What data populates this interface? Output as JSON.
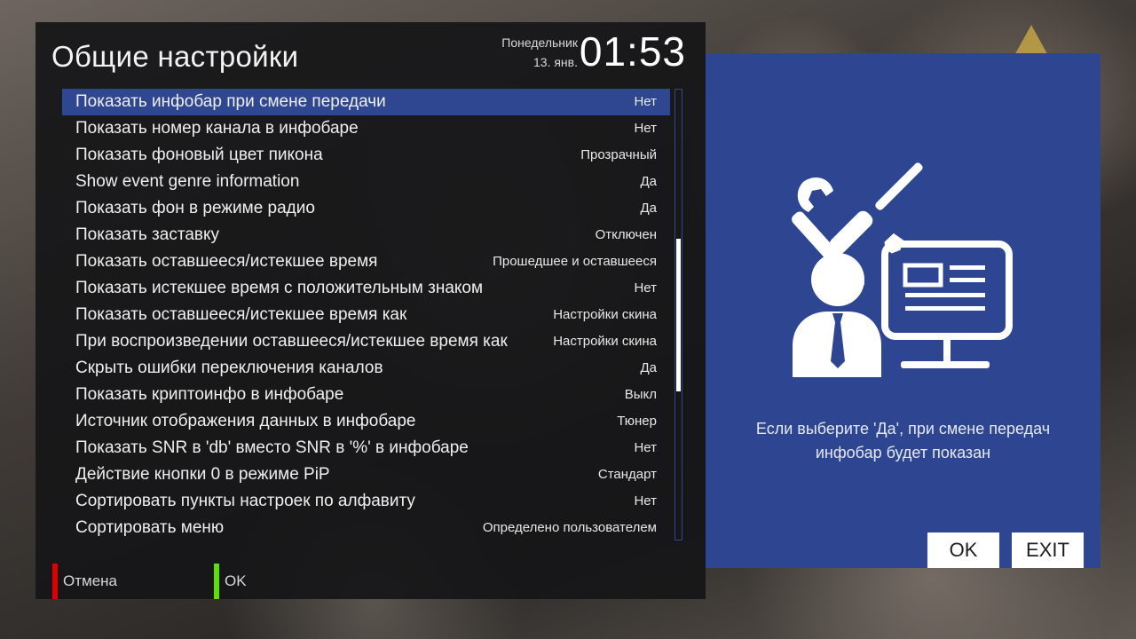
{
  "header": {
    "title": "Общие настройки",
    "weekday": "Понедельник",
    "date": "13. янв.",
    "time": "01:53"
  },
  "settings": [
    {
      "label": "Показать инфобар при смене передачи",
      "value": "Нет",
      "selected": true
    },
    {
      "label": "Показать номер канала в инфобаре",
      "value": "Нет"
    },
    {
      "label": "Показать фоновый цвет пикона",
      "value": "Прозрачный"
    },
    {
      "label": "Show event genre information",
      "value": "Да"
    },
    {
      "label": "Показать фон в режиме радио",
      "value": "Да"
    },
    {
      "label": "Показать заставку",
      "value": "Отключен"
    },
    {
      "label": "Показать оставшееся/истекшее время",
      "value": "Прошедшее и оставшееся"
    },
    {
      "label": "Показать истекшее время с положительным знаком",
      "value": "Нет"
    },
    {
      "label": "Показать оставшееся/истекшее время как",
      "value": "Настройки скина"
    },
    {
      "label": "При воспроизведении оставшееся/истекшее время как",
      "value": "Настройки скина"
    },
    {
      "label": "Скрыть ошибки переключения каналов",
      "value": "Да"
    },
    {
      "label": "Показать криптоинфо в инфобаре",
      "value": "Выкл"
    },
    {
      "label": "Источник отображения данных в инфобаре",
      "value": "Тюнер"
    },
    {
      "label": "Показать SNR в 'db' вместо SNR в '%' в инфобаре",
      "value": "Нет"
    },
    {
      "label": "Действие кнопки 0 в режиме PiP",
      "value": "Стандарт"
    },
    {
      "label": "Сортировать пункты настроек по алфавиту",
      "value": "Нет"
    },
    {
      "label": "Сортировать меню",
      "value": "Определено пользователем"
    }
  ],
  "footer": {
    "red_label": "Отмена",
    "green_label": "OK"
  },
  "info_panel": {
    "icon": "settings-admin-icon",
    "help_text": "Если выберите 'Да', при смене передач инфобар будет показан",
    "ok_label": "OK",
    "exit_label": "EXIT"
  },
  "colors": {
    "accent": "#2f4691",
    "red_key": "#e10000",
    "green_key": "#5de000"
  }
}
